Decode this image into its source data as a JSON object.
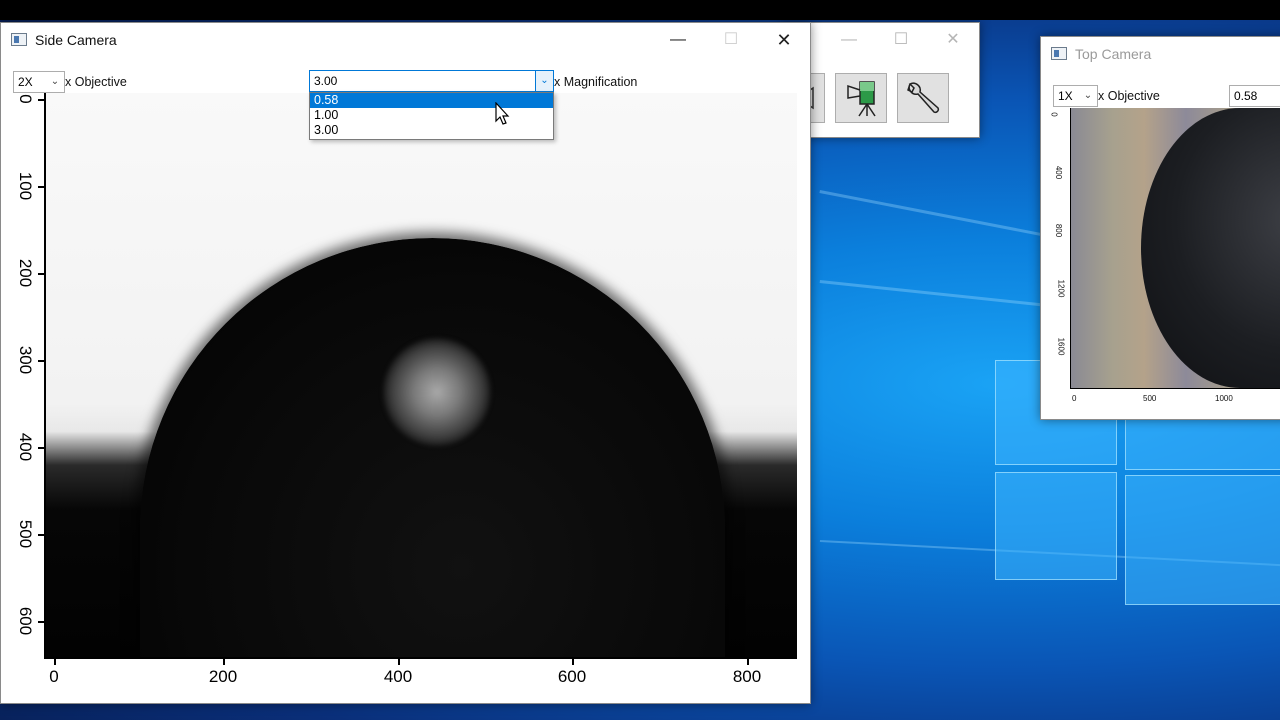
{
  "side_camera": {
    "title": "Side Camera",
    "objective_value": "2X",
    "objective_label": "x Objective",
    "magnification_value": "3.00",
    "magnification_label": "x Magnification",
    "magnification_options": [
      "0.58",
      "1.00",
      "3.00"
    ],
    "selected_option_index": 0,
    "plot": {
      "y_ticks": [
        "0",
        "100",
        "200",
        "300",
        "400",
        "500",
        "600"
      ],
      "x_ticks": [
        "0",
        "200",
        "400",
        "600",
        "800"
      ]
    }
  },
  "toolbar_window": {
    "buttons": [
      "camera-icon",
      "wrench-icon"
    ]
  },
  "top_camera": {
    "title": "Top Camera",
    "objective_value": "1X",
    "objective_label": "x Objective",
    "magnification_value": "0.58",
    "plot": {
      "y_ticks": [
        "0",
        "400",
        "800",
        "1200",
        "1600"
      ],
      "x_ticks": [
        "0",
        "500",
        "1000"
      ]
    }
  },
  "window_controls": {
    "minimize": "—",
    "maximize": "☐",
    "close": "✕"
  }
}
